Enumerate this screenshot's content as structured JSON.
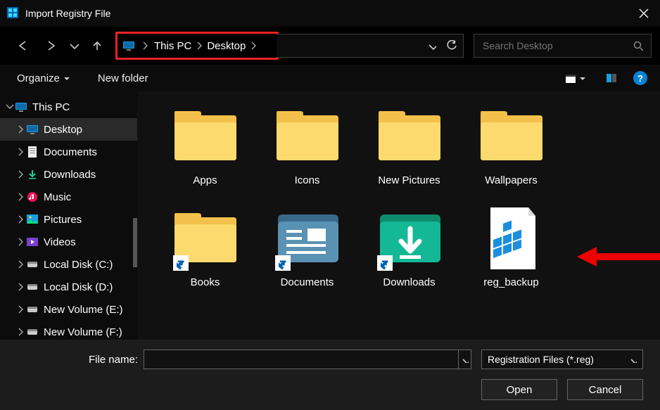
{
  "window": {
    "title": "Import Registry File"
  },
  "breadcrumb": [
    "This PC",
    "Desktop"
  ],
  "search": {
    "placeholder": "Search Desktop"
  },
  "toolbar": {
    "organize": "Organize",
    "newfolder": "New folder"
  },
  "sidebar": {
    "items": [
      {
        "label": "This PC",
        "indent": false,
        "expanded": true,
        "icon": "pc"
      },
      {
        "label": "Desktop",
        "indent": true,
        "expanded": false,
        "icon": "pc",
        "selected": true
      },
      {
        "label": "Documents",
        "indent": true,
        "expanded": false,
        "icon": "doc"
      },
      {
        "label": "Downloads",
        "indent": true,
        "expanded": false,
        "icon": "dl"
      },
      {
        "label": "Music",
        "indent": true,
        "expanded": false,
        "icon": "music"
      },
      {
        "label": "Pictures",
        "indent": true,
        "expanded": false,
        "icon": "pic"
      },
      {
        "label": "Videos",
        "indent": true,
        "expanded": false,
        "icon": "vid"
      },
      {
        "label": "Local Disk (C:)",
        "indent": true,
        "expanded": false,
        "icon": "disk"
      },
      {
        "label": "Local Disk (D:)",
        "indent": true,
        "expanded": false,
        "icon": "disk"
      },
      {
        "label": "New Volume (E:)",
        "indent": true,
        "expanded": false,
        "icon": "disk"
      },
      {
        "label": "New Volume (F:)",
        "indent": true,
        "expanded": false,
        "icon": "disk"
      }
    ]
  },
  "content": {
    "items": [
      {
        "label": "Apps",
        "icon": "folder"
      },
      {
        "label": "Icons",
        "icon": "folder"
      },
      {
        "label": "New Pictures",
        "icon": "folder"
      },
      {
        "label": "Wallpapers",
        "icon": "folder"
      },
      {
        "label": "Books",
        "icon": "folder",
        "shortcut": true
      },
      {
        "label": "Documents",
        "icon": "docfolder",
        "shortcut": true
      },
      {
        "label": "Downloads",
        "icon": "dlfolder",
        "shortcut": true
      },
      {
        "label": "reg_backup",
        "icon": "regfile"
      }
    ]
  },
  "bottom": {
    "filename_label": "File name:",
    "filename_value": "",
    "filter": "Registration Files (*.reg)",
    "open": "Open",
    "cancel": "Cancel"
  }
}
